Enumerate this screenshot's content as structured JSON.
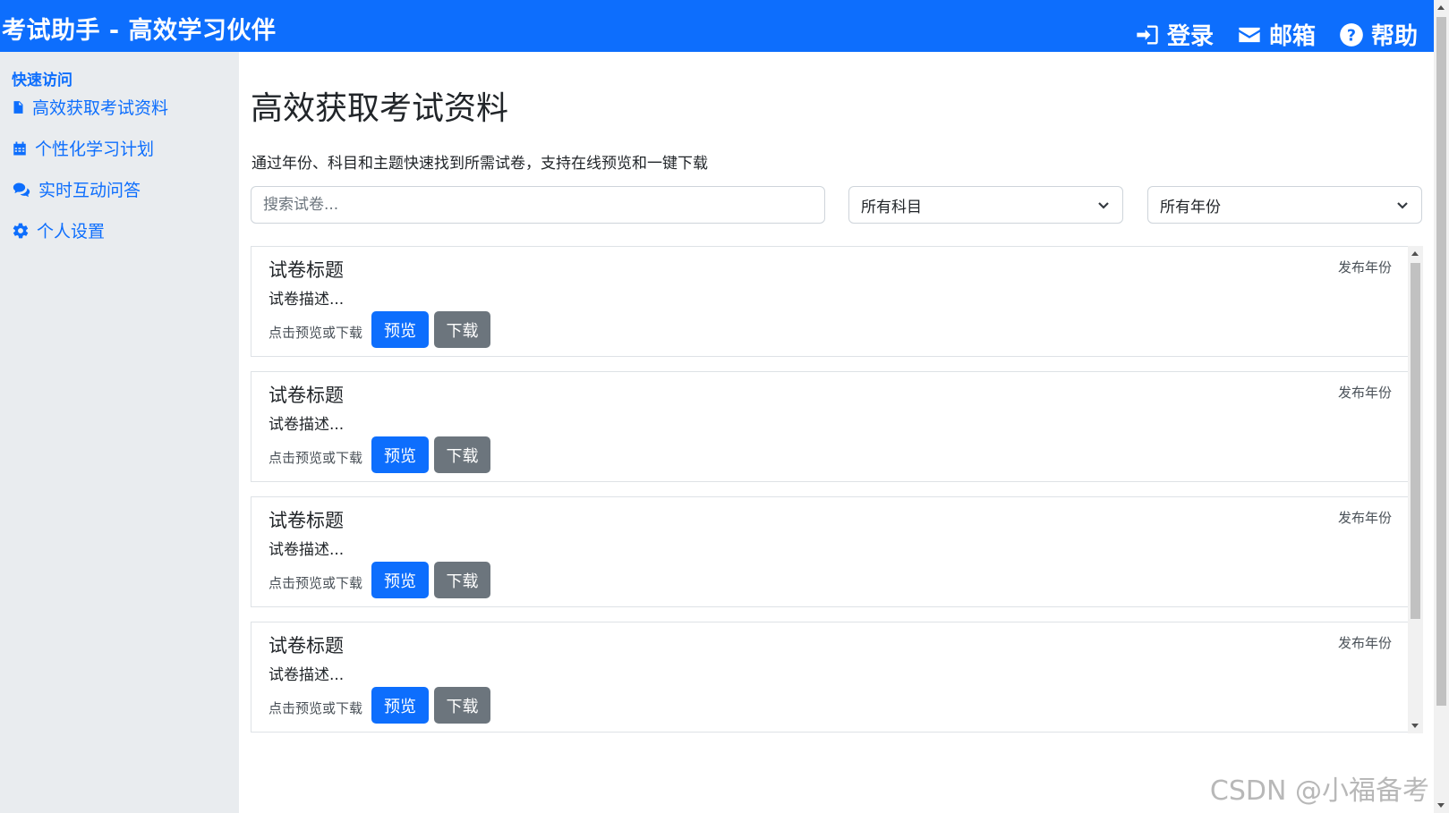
{
  "app": {
    "brand": "考试助手 - 高效学习伙伴"
  },
  "nav": [
    {
      "label": "登录",
      "icon": "login-icon"
    },
    {
      "label": "邮箱",
      "icon": "envelope-icon"
    },
    {
      "label": "帮助",
      "icon": "help-icon"
    }
  ],
  "sidebar": {
    "title": "快速访问",
    "items": [
      {
        "label": "高效获取考试资料",
        "icon": "file-icon"
      },
      {
        "label": "个性化学习计划",
        "icon": "calendar-icon"
      },
      {
        "label": "实时互动问答",
        "icon": "chat-icon"
      },
      {
        "label": "个人设置",
        "icon": "gear-icon"
      }
    ]
  },
  "main": {
    "title": "高效获取考试资料",
    "subtitle": "通过年份、科目和主题快速找到所需试卷，支持在线预览和一键下载",
    "search_placeholder": "搜索试卷...",
    "subject_select": "所有科目",
    "year_select": "所有年份"
  },
  "papers": [
    {
      "title": "试卷标题",
      "description": "试卷描述...",
      "year": "发布年份",
      "hint": "点击预览或下载",
      "preview": "预览",
      "download": "下载"
    },
    {
      "title": "试卷标题",
      "description": "试卷描述...",
      "year": "发布年份",
      "hint": "点击预览或下载",
      "preview": "预览",
      "download": "下载"
    },
    {
      "title": "试卷标题",
      "description": "试卷描述...",
      "year": "发布年份",
      "hint": "点击预览或下载",
      "preview": "预览",
      "download": "下载"
    },
    {
      "title": "试卷标题",
      "description": "试卷描述...",
      "year": "发布年份",
      "hint": "点击预览或下载",
      "preview": "预览",
      "download": "下载"
    }
  ],
  "watermark": "CSDN @小福备考",
  "colors": {
    "primary": "#0d6efd",
    "secondary": "#6c757d",
    "sidebar_bg": "#e9ecef"
  }
}
